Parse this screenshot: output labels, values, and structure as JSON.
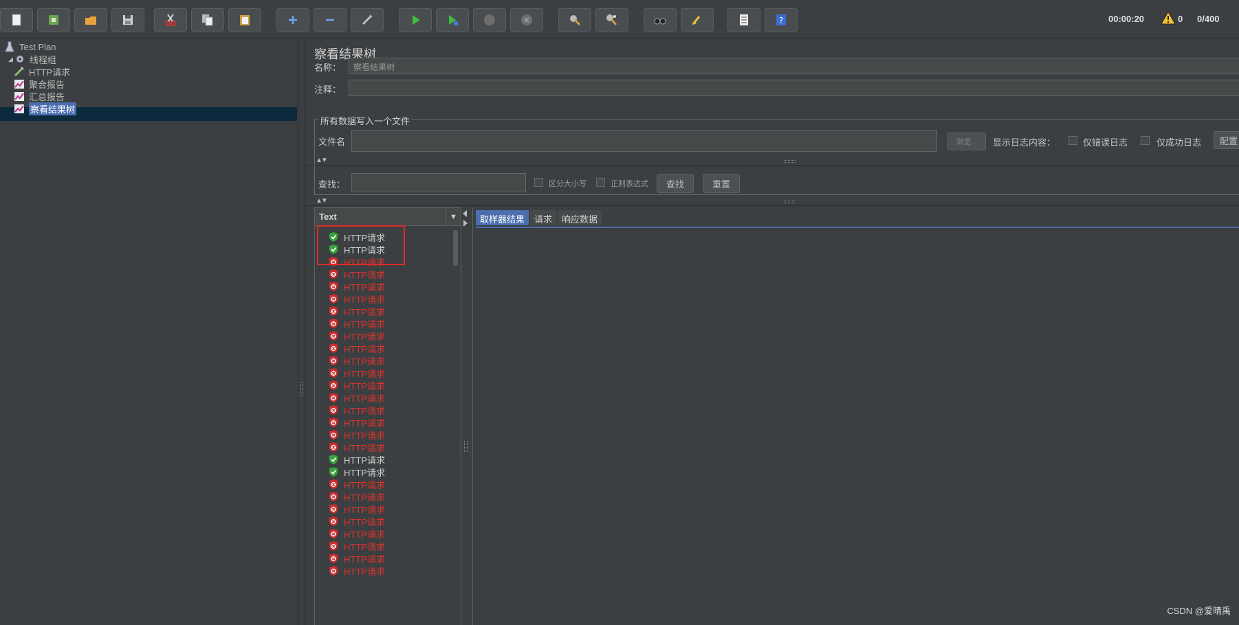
{
  "toolbar": {
    "buttons": [
      {
        "name": "new-button",
        "icon": "new-file-icon"
      },
      {
        "name": "templates-button",
        "icon": "templates-icon"
      },
      {
        "name": "open-button",
        "icon": "open-folder-icon"
      },
      {
        "name": "save-button",
        "icon": "save-icon"
      },
      {
        "name": "cut-button",
        "icon": "scissors-icon"
      },
      {
        "name": "copy-button",
        "icon": "copy-icon"
      },
      {
        "name": "paste-button",
        "icon": "paste-icon"
      },
      {
        "name": "expand-button",
        "icon": "plus-icon"
      },
      {
        "name": "collapse-button",
        "icon": "minus-icon"
      },
      {
        "name": "toggle-button",
        "icon": "wand-icon"
      },
      {
        "name": "start-button",
        "icon": "play-icon"
      },
      {
        "name": "start-no-pause-button",
        "icon": "play-timer-icon"
      },
      {
        "name": "stop-button",
        "icon": "stop-icon"
      },
      {
        "name": "shutdown-button",
        "icon": "shutdown-icon"
      },
      {
        "name": "clear-button",
        "icon": "broom-gear-icon"
      },
      {
        "name": "clear-all-button",
        "icon": "broom-gear-all-icon"
      },
      {
        "name": "search-button",
        "icon": "binoculars-icon"
      },
      {
        "name": "reset-search-button",
        "icon": "broom-icon"
      },
      {
        "name": "function-helper-button",
        "icon": "list-icon"
      },
      {
        "name": "help-button",
        "icon": "help-icon"
      }
    ],
    "timer": "00:00:20",
    "warnings": "0",
    "threads": "0/400"
  },
  "tree": [
    {
      "label": "Test Plan",
      "icon": "flask-icon",
      "level": 0
    },
    {
      "label": "线程组",
      "icon": "gear-icon",
      "level": 1
    },
    {
      "label": "HTTP请求",
      "icon": "pipette-icon",
      "level": 2
    },
    {
      "label": "聚合报告",
      "icon": "chart-icon",
      "level": 2
    },
    {
      "label": "汇总报告",
      "icon": "chart-icon",
      "level": 2
    },
    {
      "label": "察看结果树",
      "icon": "chart-icon",
      "level": 2,
      "selected": true
    }
  ],
  "panel": {
    "title": "察看结果树",
    "name_label": "名称：",
    "name_value": "察看结果树",
    "comment_label": "注释：",
    "comment_value": "",
    "group_title": "所有数据写入一个文件",
    "filename_label": "文件名",
    "filename_value": "",
    "browse_label": "浏览...",
    "log_label": "显示日志内容：",
    "errors_only_label": "仅错误日志",
    "success_only_label": "仅成功日志",
    "config_label": "配置",
    "search_label": "查找：",
    "search_value": "",
    "case_label": "区分大小写",
    "regex_label": "正则表达式",
    "find_label": "查找",
    "reset_label": "重置"
  },
  "results": {
    "header": "Text",
    "items": [
      {
        "label": "HTTP请求",
        "status": "ok"
      },
      {
        "label": "HTTP请求",
        "status": "ok"
      },
      {
        "label": "HTTP请求",
        "status": "err"
      },
      {
        "label": "HTTP请求",
        "status": "err"
      },
      {
        "label": "HTTP请求",
        "status": "err"
      },
      {
        "label": "HTTP请求",
        "status": "err"
      },
      {
        "label": "HTTP请求",
        "status": "err"
      },
      {
        "label": "HTTP请求",
        "status": "err"
      },
      {
        "label": "HTTP请求",
        "status": "err"
      },
      {
        "label": "HTTP请求",
        "status": "err"
      },
      {
        "label": "HTTP请求",
        "status": "err"
      },
      {
        "label": "HTTP请求",
        "status": "err"
      },
      {
        "label": "HTTP请求",
        "status": "err"
      },
      {
        "label": "HTTP请求",
        "status": "err"
      },
      {
        "label": "HTTP请求",
        "status": "err"
      },
      {
        "label": "HTTP请求",
        "status": "err"
      },
      {
        "label": "HTTP请求",
        "status": "err"
      },
      {
        "label": "HTTP请求",
        "status": "err"
      },
      {
        "label": "HTTP请求",
        "status": "ok"
      },
      {
        "label": "HTTP请求",
        "status": "ok"
      },
      {
        "label": "HTTP请求",
        "status": "err"
      },
      {
        "label": "HTTP请求",
        "status": "err"
      },
      {
        "label": "HTTP请求",
        "status": "err"
      },
      {
        "label": "HTTP请求",
        "status": "err"
      },
      {
        "label": "HTTP请求",
        "status": "err"
      },
      {
        "label": "HTTP请求",
        "status": "err"
      },
      {
        "label": "HTTP请求",
        "status": "err"
      },
      {
        "label": "HTTP请求",
        "status": "err"
      }
    ]
  },
  "detail_tabs": [
    {
      "label": "取样器结果",
      "active": true
    },
    {
      "label": "请求",
      "active": false
    },
    {
      "label": "响应数据",
      "active": false
    }
  ],
  "watermark": "CSDN @爱晴禹",
  "colors": {
    "ok": "#3aa33a",
    "err": "#d12d2d",
    "accent": "#4b6eaf"
  }
}
